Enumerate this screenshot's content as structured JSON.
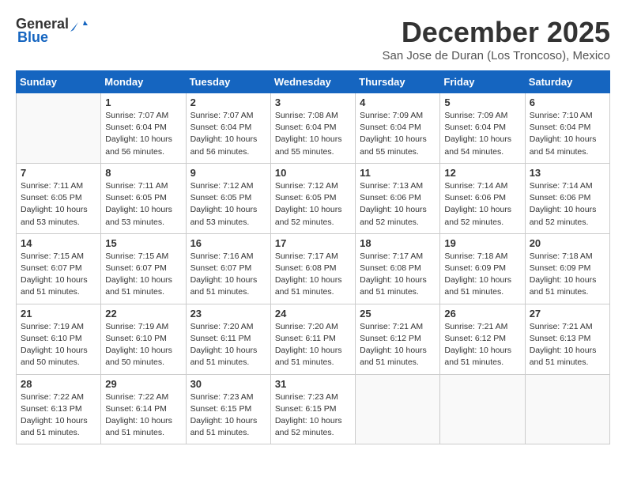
{
  "header": {
    "logo_general": "General",
    "logo_blue": "Blue",
    "month": "December 2025",
    "location": "San Jose de Duran (Los Troncoso), Mexico"
  },
  "weekdays": [
    "Sunday",
    "Monday",
    "Tuesday",
    "Wednesday",
    "Thursday",
    "Friday",
    "Saturday"
  ],
  "weeks": [
    [
      {
        "day": "",
        "info": ""
      },
      {
        "day": "1",
        "info": "Sunrise: 7:07 AM\nSunset: 6:04 PM\nDaylight: 10 hours\nand 56 minutes."
      },
      {
        "day": "2",
        "info": "Sunrise: 7:07 AM\nSunset: 6:04 PM\nDaylight: 10 hours\nand 56 minutes."
      },
      {
        "day": "3",
        "info": "Sunrise: 7:08 AM\nSunset: 6:04 PM\nDaylight: 10 hours\nand 55 minutes."
      },
      {
        "day": "4",
        "info": "Sunrise: 7:09 AM\nSunset: 6:04 PM\nDaylight: 10 hours\nand 55 minutes."
      },
      {
        "day": "5",
        "info": "Sunrise: 7:09 AM\nSunset: 6:04 PM\nDaylight: 10 hours\nand 54 minutes."
      },
      {
        "day": "6",
        "info": "Sunrise: 7:10 AM\nSunset: 6:04 PM\nDaylight: 10 hours\nand 54 minutes."
      }
    ],
    [
      {
        "day": "7",
        "info": "Sunrise: 7:11 AM\nSunset: 6:05 PM\nDaylight: 10 hours\nand 53 minutes."
      },
      {
        "day": "8",
        "info": "Sunrise: 7:11 AM\nSunset: 6:05 PM\nDaylight: 10 hours\nand 53 minutes."
      },
      {
        "day": "9",
        "info": "Sunrise: 7:12 AM\nSunset: 6:05 PM\nDaylight: 10 hours\nand 53 minutes."
      },
      {
        "day": "10",
        "info": "Sunrise: 7:12 AM\nSunset: 6:05 PM\nDaylight: 10 hours\nand 52 minutes."
      },
      {
        "day": "11",
        "info": "Sunrise: 7:13 AM\nSunset: 6:06 PM\nDaylight: 10 hours\nand 52 minutes."
      },
      {
        "day": "12",
        "info": "Sunrise: 7:14 AM\nSunset: 6:06 PM\nDaylight: 10 hours\nand 52 minutes."
      },
      {
        "day": "13",
        "info": "Sunrise: 7:14 AM\nSunset: 6:06 PM\nDaylight: 10 hours\nand 52 minutes."
      }
    ],
    [
      {
        "day": "14",
        "info": "Sunrise: 7:15 AM\nSunset: 6:07 PM\nDaylight: 10 hours\nand 51 minutes."
      },
      {
        "day": "15",
        "info": "Sunrise: 7:15 AM\nSunset: 6:07 PM\nDaylight: 10 hours\nand 51 minutes."
      },
      {
        "day": "16",
        "info": "Sunrise: 7:16 AM\nSunset: 6:07 PM\nDaylight: 10 hours\nand 51 minutes."
      },
      {
        "day": "17",
        "info": "Sunrise: 7:17 AM\nSunset: 6:08 PM\nDaylight: 10 hours\nand 51 minutes."
      },
      {
        "day": "18",
        "info": "Sunrise: 7:17 AM\nSunset: 6:08 PM\nDaylight: 10 hours\nand 51 minutes."
      },
      {
        "day": "19",
        "info": "Sunrise: 7:18 AM\nSunset: 6:09 PM\nDaylight: 10 hours\nand 51 minutes."
      },
      {
        "day": "20",
        "info": "Sunrise: 7:18 AM\nSunset: 6:09 PM\nDaylight: 10 hours\nand 51 minutes."
      }
    ],
    [
      {
        "day": "21",
        "info": "Sunrise: 7:19 AM\nSunset: 6:10 PM\nDaylight: 10 hours\nand 50 minutes."
      },
      {
        "day": "22",
        "info": "Sunrise: 7:19 AM\nSunset: 6:10 PM\nDaylight: 10 hours\nand 50 minutes."
      },
      {
        "day": "23",
        "info": "Sunrise: 7:20 AM\nSunset: 6:11 PM\nDaylight: 10 hours\nand 51 minutes."
      },
      {
        "day": "24",
        "info": "Sunrise: 7:20 AM\nSunset: 6:11 PM\nDaylight: 10 hours\nand 51 minutes."
      },
      {
        "day": "25",
        "info": "Sunrise: 7:21 AM\nSunset: 6:12 PM\nDaylight: 10 hours\nand 51 minutes."
      },
      {
        "day": "26",
        "info": "Sunrise: 7:21 AM\nSunset: 6:12 PM\nDaylight: 10 hours\nand 51 minutes."
      },
      {
        "day": "27",
        "info": "Sunrise: 7:21 AM\nSunset: 6:13 PM\nDaylight: 10 hours\nand 51 minutes."
      }
    ],
    [
      {
        "day": "28",
        "info": "Sunrise: 7:22 AM\nSunset: 6:13 PM\nDaylight: 10 hours\nand 51 minutes."
      },
      {
        "day": "29",
        "info": "Sunrise: 7:22 AM\nSunset: 6:14 PM\nDaylight: 10 hours\nand 51 minutes."
      },
      {
        "day": "30",
        "info": "Sunrise: 7:23 AM\nSunset: 6:15 PM\nDaylight: 10 hours\nand 51 minutes."
      },
      {
        "day": "31",
        "info": "Sunrise: 7:23 AM\nSunset: 6:15 PM\nDaylight: 10 hours\nand 52 minutes."
      },
      {
        "day": "",
        "info": ""
      },
      {
        "day": "",
        "info": ""
      },
      {
        "day": "",
        "info": ""
      }
    ]
  ]
}
